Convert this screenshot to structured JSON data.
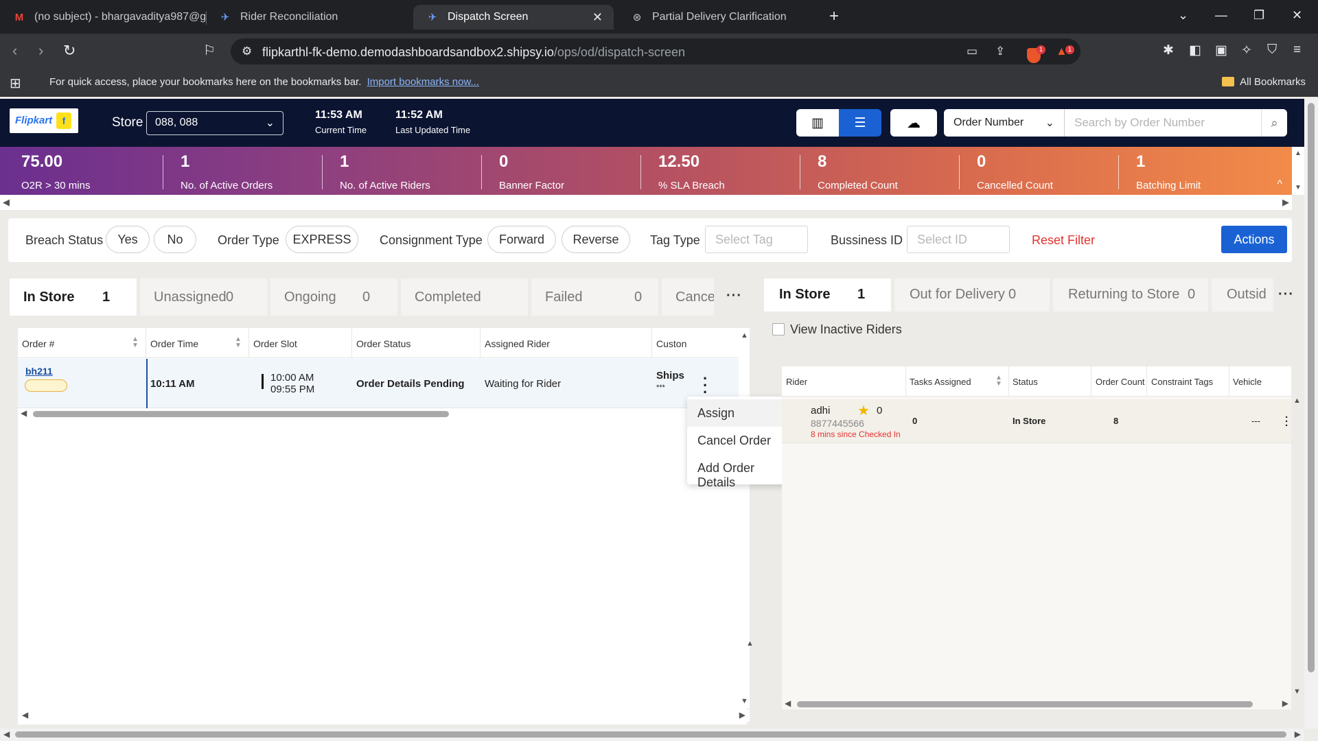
{
  "browser": {
    "tabs": [
      {
        "title": "(no subject) - bhargavaditya987@g",
        "icon": "gmail-icon"
      },
      {
        "title": "Rider Reconciliation",
        "icon": "shipsy-icon"
      },
      {
        "title": "Dispatch Screen",
        "icon": "shipsy-icon"
      },
      {
        "title": "Partial Delivery Clarification",
        "icon": "chatgpt-icon"
      }
    ],
    "url_host": "flipkarthl-fk-demo.demodashboardsandbox2.shipsy.io",
    "url_path": "/ops/od/dispatch-screen",
    "brave_badge": "1",
    "alert_badge": "1",
    "bookmarks_text": "For quick access, place your bookmarks here on the bookmarks bar.",
    "bookmarks_link": "Import bookmarks now...",
    "all_bookmarks": "All Bookmarks"
  },
  "header": {
    "logo_text": "Flipkart",
    "store_label": "Store",
    "store_value": "088, 088",
    "current_time": "11:53 AM",
    "current_time_label": "Current Time",
    "last_updated": "11:52 AM",
    "last_updated_label": "Last Updated Time",
    "search_type": "Order Number",
    "search_placeholder": "Search by Order Number"
  },
  "stats": [
    {
      "value": "75.00",
      "label": "O2R > 30 mins"
    },
    {
      "value": "1",
      "label": "No. of Active Orders"
    },
    {
      "value": "1",
      "label": "No. of Active Riders"
    },
    {
      "value": "0",
      "label": "Banner Factor"
    },
    {
      "value": "12.50",
      "label": "% SLA Breach"
    },
    {
      "value": "8",
      "label": "Completed Count"
    },
    {
      "value": "0",
      "label": "Cancelled Count"
    },
    {
      "value": "1",
      "label": "Batching Limit"
    }
  ],
  "filters": {
    "breach_status_label": "Breach Status",
    "breach_yes": "Yes",
    "breach_no": "No",
    "order_type_label": "Order Type",
    "order_type_value": "EXPRESS",
    "consignment_type_label": "Consignment Type",
    "consignment_forward": "Forward",
    "consignment_reverse": "Reverse",
    "tag_type_label": "Tag Type",
    "tag_placeholder": "Select Tag",
    "business_id_label": "Bussiness ID",
    "business_id_placeholder": "Select ID",
    "reset_label": "Reset Filter",
    "actions_label": "Actions"
  },
  "orders_panel": {
    "tabs": [
      {
        "label": "In Store",
        "count": "1"
      },
      {
        "label": "Unassigned",
        "count": "0"
      },
      {
        "label": "Ongoing",
        "count": "0"
      },
      {
        "label": "Completed",
        "count": ""
      },
      {
        "label": "Failed",
        "count": "0"
      },
      {
        "label": "Cance",
        "count": ""
      }
    ],
    "columns": [
      "Order #",
      "Order Time",
      "Order Slot",
      "Order Status",
      "Assigned Rider",
      "Custon"
    ],
    "rows": [
      {
        "order_no": "bh211",
        "order_time": "10:11 AM",
        "slot_start": "10:00 AM",
        "slot_end": "09:55 PM",
        "status": "Order Details Pending",
        "rider": "Waiting for Rider",
        "customer": "Ships",
        "customer_sub": "***"
      }
    ]
  },
  "context_menu": [
    "Assign",
    "Cancel Order",
    "Add Order Details"
  ],
  "riders_panel": {
    "tabs": [
      {
        "label": "In Store",
        "count": "1"
      },
      {
        "label": "Out for Delivery",
        "count": "0"
      },
      {
        "label": "Returning to Store",
        "count": "0"
      },
      {
        "label": "Outsid",
        "count": ""
      }
    ],
    "inactive_label": "View Inactive Riders",
    "columns": [
      "Rider",
      "Tasks Assigned",
      "Status",
      "Order Count",
      "Constraint Tags",
      "Vehicle"
    ],
    "rows": [
      {
        "name": "adhi",
        "rating": "0",
        "phone": "8877445566",
        "since": "8 mins since Checked In",
        "tasks": "0",
        "status": "In Store",
        "order_count": "8",
        "constraint_tags": "",
        "vehicle": "---"
      }
    ]
  }
}
